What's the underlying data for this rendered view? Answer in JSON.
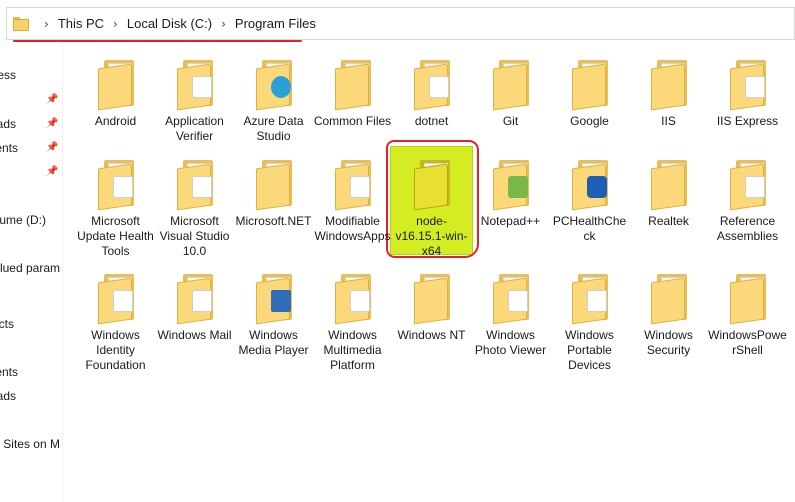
{
  "address_bar": {
    "crumbs": [
      "This PC",
      "Local Disk (C:)",
      "Program Files"
    ],
    "separator": "›"
  },
  "nav_pane": {
    "items": [
      {
        "label": "ess",
        "pinned": false
      },
      {
        "label": "ads",
        "pinned": true
      },
      {
        "label": "ents",
        "pinned": true
      },
      {
        "label": "",
        "pinned": true
      },
      {
        "label": "ume (D:)",
        "pinned": false
      },
      {
        "label": "lued param",
        "pinned": false
      },
      {
        "label": "cts",
        "pinned": false
      },
      {
        "label": "ents",
        "pinned": false
      },
      {
        "label": "ads",
        "pinned": false
      },
      {
        "label": "Sites on M",
        "pinned": false
      }
    ],
    "pinned_icon": "pin-icon"
  },
  "folders": [
    {
      "label": "Android",
      "badge": "none"
    },
    {
      "label": "Application Verifier",
      "badge": "doc"
    },
    {
      "label": "Azure Data Studio",
      "badge": "azure"
    },
    {
      "label": "Common Files",
      "badge": "none"
    },
    {
      "label": "dotnet",
      "badge": "doc"
    },
    {
      "label": "Git",
      "badge": "none"
    },
    {
      "label": "Google",
      "badge": "none"
    },
    {
      "label": "IIS",
      "badge": "none"
    },
    {
      "label": "IIS Express",
      "badge": "gear"
    },
    {
      "label": "Microsoft Update Health Tools",
      "badge": "gear"
    },
    {
      "label": "Microsoft Visual Studio 10.0",
      "badge": "gear"
    },
    {
      "label": "Microsoft.NET",
      "badge": "none"
    },
    {
      "label": "Modifiable WindowsApps",
      "badge": "plain"
    },
    {
      "label": "node-v16.15.1-win-x64",
      "badge": "selected"
    },
    {
      "label": "Notepad++",
      "badge": "notepad"
    },
    {
      "label": "PCHealthCheck",
      "badge": "pchealth"
    },
    {
      "label": "Realtek",
      "badge": "none"
    },
    {
      "label": "Reference Assemblies",
      "badge": "gear"
    },
    {
      "label": "Windows Identity Foundation",
      "badge": "gear"
    },
    {
      "label": "Windows Mail",
      "badge": "doc"
    },
    {
      "label": "Windows Media Player",
      "badge": "media"
    },
    {
      "label": "Windows Multimedia Platform",
      "badge": "gear"
    },
    {
      "label": "Windows NT",
      "badge": "none"
    },
    {
      "label": "Windows Photo Viewer",
      "badge": "gear"
    },
    {
      "label": "Windows Portable Devices",
      "badge": "gear"
    },
    {
      "label": "Windows Security",
      "badge": "none"
    },
    {
      "label": "WindowsPowerShell",
      "badge": "none"
    }
  ],
  "colors": {
    "selection_fill": "#d4ec22",
    "annotation_red": "#e4222b",
    "folder_yellow": "#fbd97a"
  }
}
